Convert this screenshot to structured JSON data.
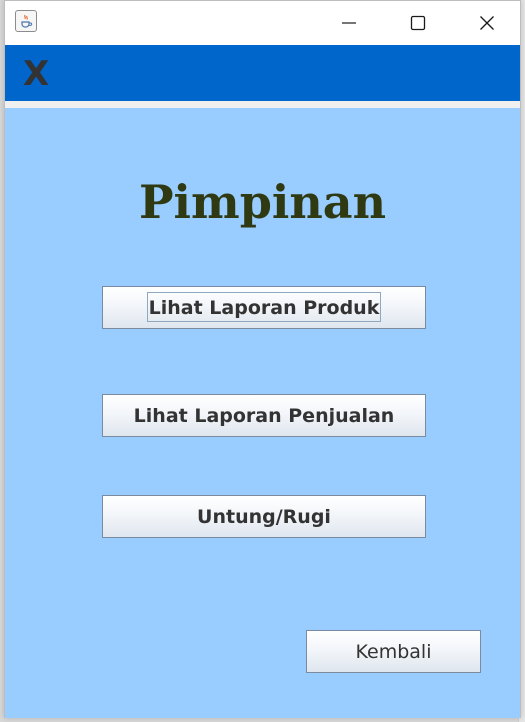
{
  "window": {
    "title_icon": "java-coffee-icon",
    "controls": {
      "minimize": "minimize-icon",
      "maximize": "maximize-icon",
      "close": "close-icon"
    }
  },
  "header": {
    "close_label": "X",
    "color": "#0066cc"
  },
  "main": {
    "title": "Pimpinan",
    "background": "#99ccff",
    "buttons": {
      "produk": "Lihat Laporan Produk",
      "penjualan": "Lihat Laporan Penjualan",
      "untung_rugi": "Untung/Rugi",
      "kembali": "Kembali"
    }
  }
}
